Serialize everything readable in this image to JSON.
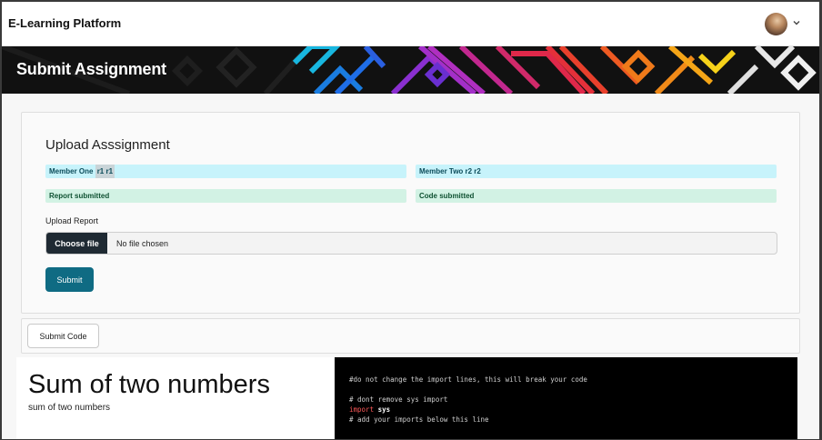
{
  "navbar": {
    "brand": "E-Learning Platform",
    "avatar_icon": "user-avatar",
    "menu_icon": "chevron-down-icon"
  },
  "banner": {
    "title": "Submit Assignment"
  },
  "upload_card": {
    "title": "Upload Asssignment",
    "members": [
      {
        "prefix": "Member One ",
        "highlight": "r1 r1"
      },
      {
        "label": "Member Two r2 r2"
      }
    ],
    "statuses": [
      "Report submitted",
      "Code submitted"
    ],
    "upload_label": "Upload Report",
    "file_button": "Choose file",
    "file_status": "No file chosen",
    "submit_label": "Submit"
  },
  "code_card": {
    "button_label": "Submit Code"
  },
  "problem": {
    "title": "Sum of two numbers",
    "description": "sum of two numbers"
  },
  "editor": {
    "lines": [
      "#do not change the import lines, this will break your code",
      "",
      "# dont remove sys import",
      "import sys",
      "# add your imports below this line"
    ],
    "import_keyword": "import",
    "import_module": "sys"
  },
  "colors": {
    "info_bg": "#c7f3fb",
    "success_bg": "#d2f2e4",
    "primary": "#0f6b83",
    "dark_button": "#1f2a33"
  }
}
